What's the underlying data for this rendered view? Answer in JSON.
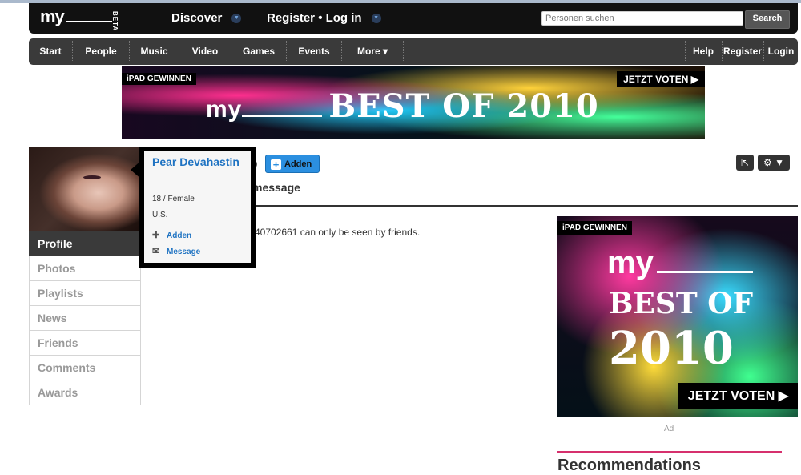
{
  "header": {
    "logo": "my",
    "beta": "BETA",
    "discover": "Discover",
    "register_login": "Register • Log in",
    "dropdown_glyph": "▼",
    "search_placeholder": "Personen suchen",
    "search_button": "Search"
  },
  "nav": {
    "left": [
      "Start",
      "People",
      "Music",
      "Video",
      "Games",
      "Events",
      "More ▾"
    ],
    "right": [
      "Help",
      "Register",
      "Login"
    ]
  },
  "banner_top": {
    "ipad": "iPAD GEWINNEN",
    "vote": "JETZT VOTEN ▶",
    "my": "my",
    "title": "BEST OF 2010"
  },
  "popover": {
    "name": "Pear Devahastin",
    "age_gender": "18 / Female",
    "country": "U.S.",
    "add": "Adden",
    "message": "Message"
  },
  "profile": {
    "add_button": "Adden",
    "message_tab": "message",
    "notice": "40702661 can only be seen by friends.",
    "share_icon": "⇱",
    "gear_icon": "⚙",
    "caret": "▼"
  },
  "sidebar": {
    "items": [
      "Profile",
      "Photos",
      "Playlists",
      "News",
      "Friends",
      "Comments",
      "Awards"
    ]
  },
  "ad_right": {
    "ipad": "iPAD GEWINNEN",
    "my": "my",
    "best": "BEST OF",
    "year": "2010",
    "vote": "JETZT VOTEN ▶",
    "label": "Ad"
  },
  "recommendations": {
    "title": "Recommendations"
  },
  "colors": {
    "link_blue": "#1f73c2",
    "button_blue": "#2b8fe0",
    "accent_pink": "#d6306d",
    "nav_dark": "#3a3a3a"
  }
}
